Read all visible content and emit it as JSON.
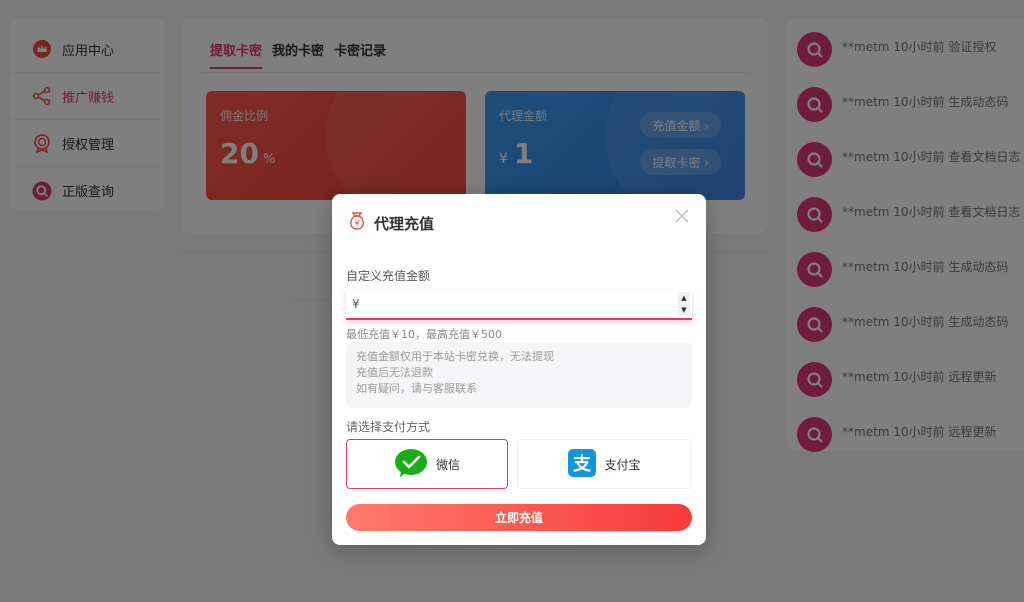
{
  "sidebar": {
    "items": [
      {
        "label": "应用中心",
        "icon": "crown-icon"
      },
      {
        "label": "推广赚钱",
        "icon": "share-icon",
        "active": true
      },
      {
        "label": "授权管理",
        "icon": "badge-icon"
      },
      {
        "label": "正版查询",
        "icon": "search-icon"
      }
    ]
  },
  "main": {
    "tabs": [
      "提取卡密",
      "我的卡密",
      "卡密记录"
    ],
    "commission": {
      "title": "佣金比例",
      "value": "20",
      "unit": "%"
    },
    "agent": {
      "title": "代理金额",
      "currency": "¥",
      "value": "1",
      "btn_recharge": "充值金额 ›",
      "btn_extract": "提取卡密 ›"
    }
  },
  "logs": [
    {
      "text": "**metm 10小时前 验证授权"
    },
    {
      "text": "**metm 10小时前 生成动态码"
    },
    {
      "text": "**metm 10小时前 查看文档日志"
    },
    {
      "text": "**metm 10小时前 查看文档日志"
    },
    {
      "text": "**metm 10小时前 生成动态码"
    },
    {
      "text": "**metm 10小时前 生成动态码"
    },
    {
      "text": "**metm 10小时前 远程更新"
    },
    {
      "text": "**metm 10小时前 远程更新"
    }
  ],
  "modal": {
    "title": "代理充值",
    "field_label": "自定义充值金额",
    "currency": "¥",
    "amount_value": "",
    "hint": "最低充值￥10，最高充值￥500",
    "notice": [
      "充值金额仅用于本站卡密兑换，无法提现",
      "充值后无法退款",
      "如有疑问，请与客服联系"
    ],
    "pay_label": "请选择支付方式",
    "pay_wechat": "微信",
    "pay_alipay": "支付宝",
    "submit": "立即充值"
  },
  "colors": {
    "accent": "#e0397a",
    "red": "#f23b3b",
    "blue": "#2f7fe6",
    "wechat": "#1aad19",
    "alipay": "#1296db"
  }
}
